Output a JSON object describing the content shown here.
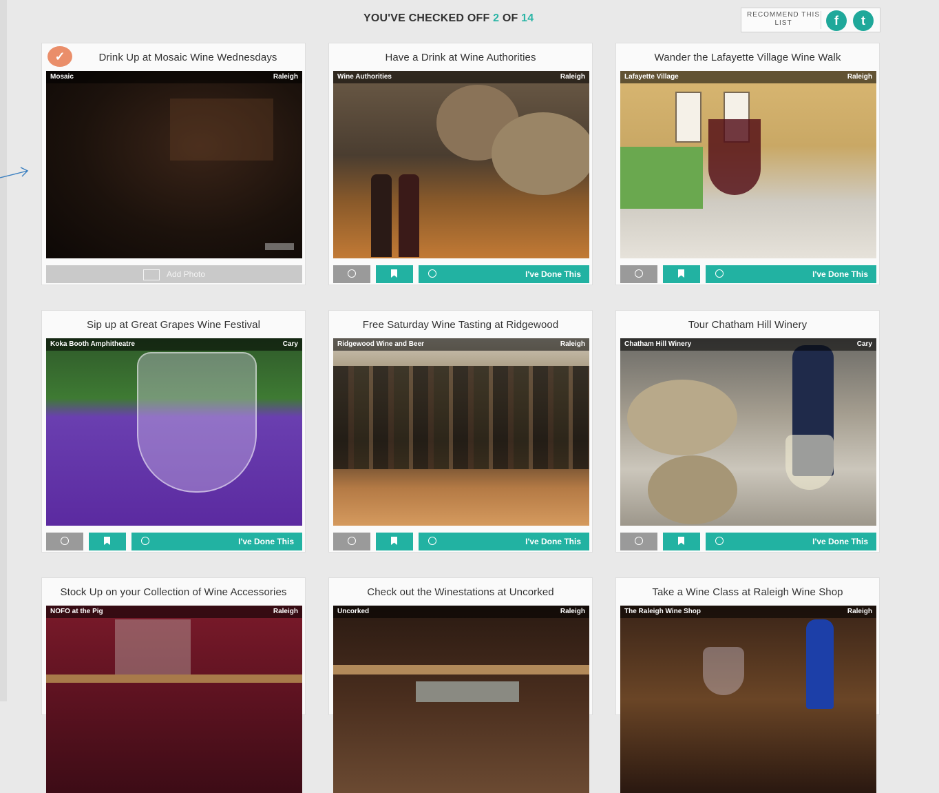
{
  "header": {
    "progress_prefix": "YOU'VE CHECKED OFF",
    "checked_count": "2",
    "progress_of": "OF",
    "total_count": "14",
    "recommend_label": "RECOMMEND THIS LIST",
    "facebook_glyph": "f",
    "twitter_glyph": "t"
  },
  "buttons": {
    "done_label": "I've Done This",
    "add_photo_label": "Add Photo"
  },
  "cards": [
    {
      "title": "Drink Up at Mosaic Wine Wednesdays",
      "venue": "Mosaic",
      "city": "Raleigh",
      "checked": true
    },
    {
      "title": "Have a Drink at Wine Authorities",
      "venue": "Wine Authorities",
      "city": "Raleigh",
      "checked": false
    },
    {
      "title": "Wander the Lafayette Village Wine Walk",
      "venue": "Lafayette Village",
      "city": "Raleigh",
      "checked": false
    },
    {
      "title": "Sip up at Great Grapes Wine Festival",
      "venue": "Koka Booth Amphitheatre",
      "city": "Cary",
      "checked": false
    },
    {
      "title": "Free Saturday Wine Tasting at Ridgewood",
      "venue": "Ridgewood Wine and Beer",
      "city": "Raleigh",
      "checked": false
    },
    {
      "title": "Tour Chatham Hill Winery",
      "venue": "Chatham Hill Winery",
      "city": "Cary",
      "checked": false
    },
    {
      "title": "Stock Up on your Collection of Wine Accessories",
      "venue": "NOFO at the Pig",
      "city": "Raleigh",
      "checked": false
    },
    {
      "title": "Check out the Winestations at Uncorked",
      "venue": "Uncorked",
      "city": "Raleigh",
      "checked": false
    },
    {
      "title": "Take a Wine Class at Raleigh Wine Shop",
      "venue": "The Raleigh Wine Shop",
      "city": "Raleigh",
      "checked": false
    }
  ],
  "colors": {
    "accent": "#22b2a2",
    "checked_badge": "#ea8e6a",
    "info_button": "#9a9a9a",
    "background": "#e9e9e9"
  },
  "icons": {
    "info": "info-icon",
    "bookmark": "bookmark-icon",
    "done": "check-circle-icon",
    "facebook": "facebook-icon",
    "twitter": "twitter-icon",
    "camera": "camera-icon",
    "location": "location-pin-icon",
    "venue": "venue-icon"
  }
}
